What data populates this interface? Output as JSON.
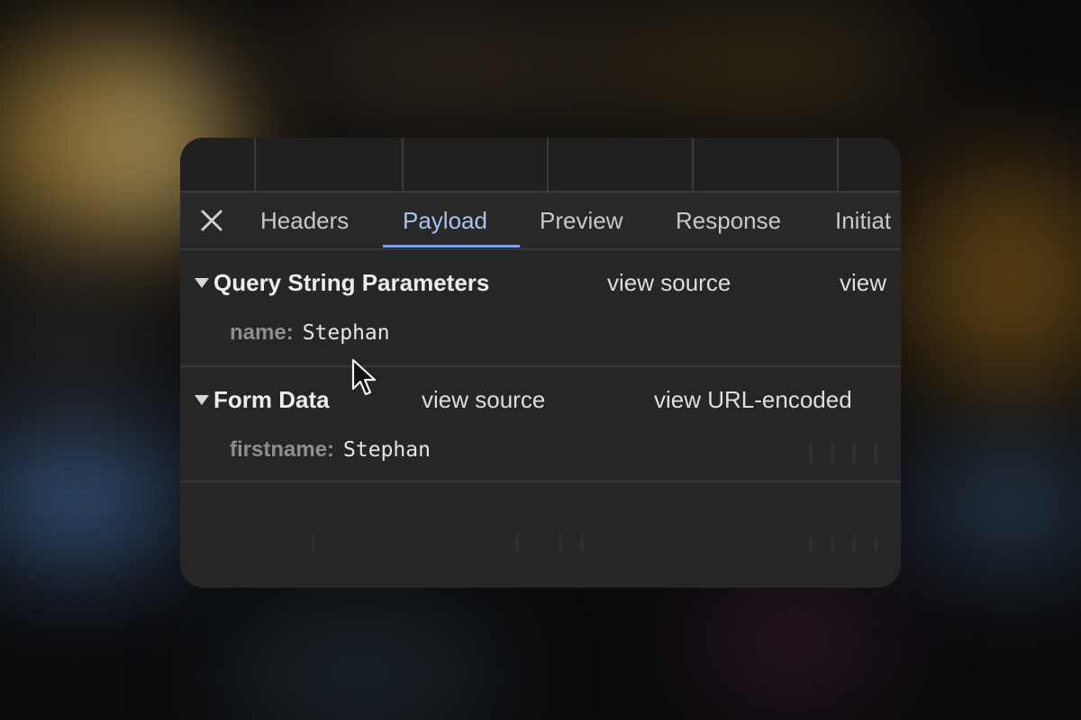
{
  "tabs": [
    {
      "label": "Headers",
      "active": false
    },
    {
      "label": "Payload",
      "active": true
    },
    {
      "label": "Preview",
      "active": false
    },
    {
      "label": "Response",
      "active": false
    },
    {
      "label": "Initiat",
      "active": false
    }
  ],
  "icons": {
    "close": "close-icon",
    "expand": "triangle-down-icon",
    "cursor": "mouse-pointer-icon"
  },
  "query_section": {
    "title": "Query String Parameters",
    "view_source_label": "view source",
    "view_encoded_label": "view",
    "params": [
      {
        "key": "name:",
        "value": "Stephan"
      }
    ]
  },
  "form_section": {
    "title": "Form Data",
    "view_source_label": "view source",
    "view_encoded_label": "view URL-encoded",
    "params": [
      {
        "key": "firstname:",
        "value": "Stephan"
      }
    ]
  },
  "colors": {
    "panel_bg": "#262626",
    "active_tab": "#a9c2ef",
    "active_underline": "#7ea2e8",
    "key_text": "#8e8e8e"
  }
}
